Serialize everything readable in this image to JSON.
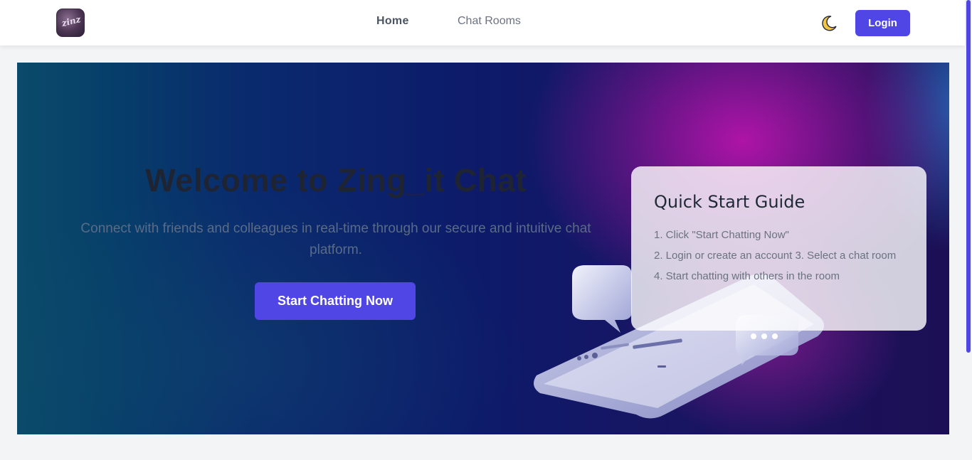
{
  "nav": {
    "logo_text": "zinz",
    "links": [
      {
        "label": "Home"
      },
      {
        "label": "Chat Rooms"
      }
    ],
    "theme_icon": "moon-icon",
    "login_label": "Login"
  },
  "hero": {
    "title": "Welcome to Zing_it Chat",
    "subtitle": "Connect with friends and colleagues in real-time through our secure and intuitive chat platform.",
    "cta_label": "Start Chatting Now"
  },
  "guide": {
    "title": "Quick Start Guide",
    "steps_line1": "1. Click \"Start Chatting Now\"",
    "steps_line2": "2. Login or create an account 3. Select a chat room",
    "steps_line3": "4. Start chatting with others in the room"
  },
  "colors": {
    "accent": "#4f46e5",
    "page_bg": "#f3f4f6",
    "moon": "#f5c542"
  }
}
